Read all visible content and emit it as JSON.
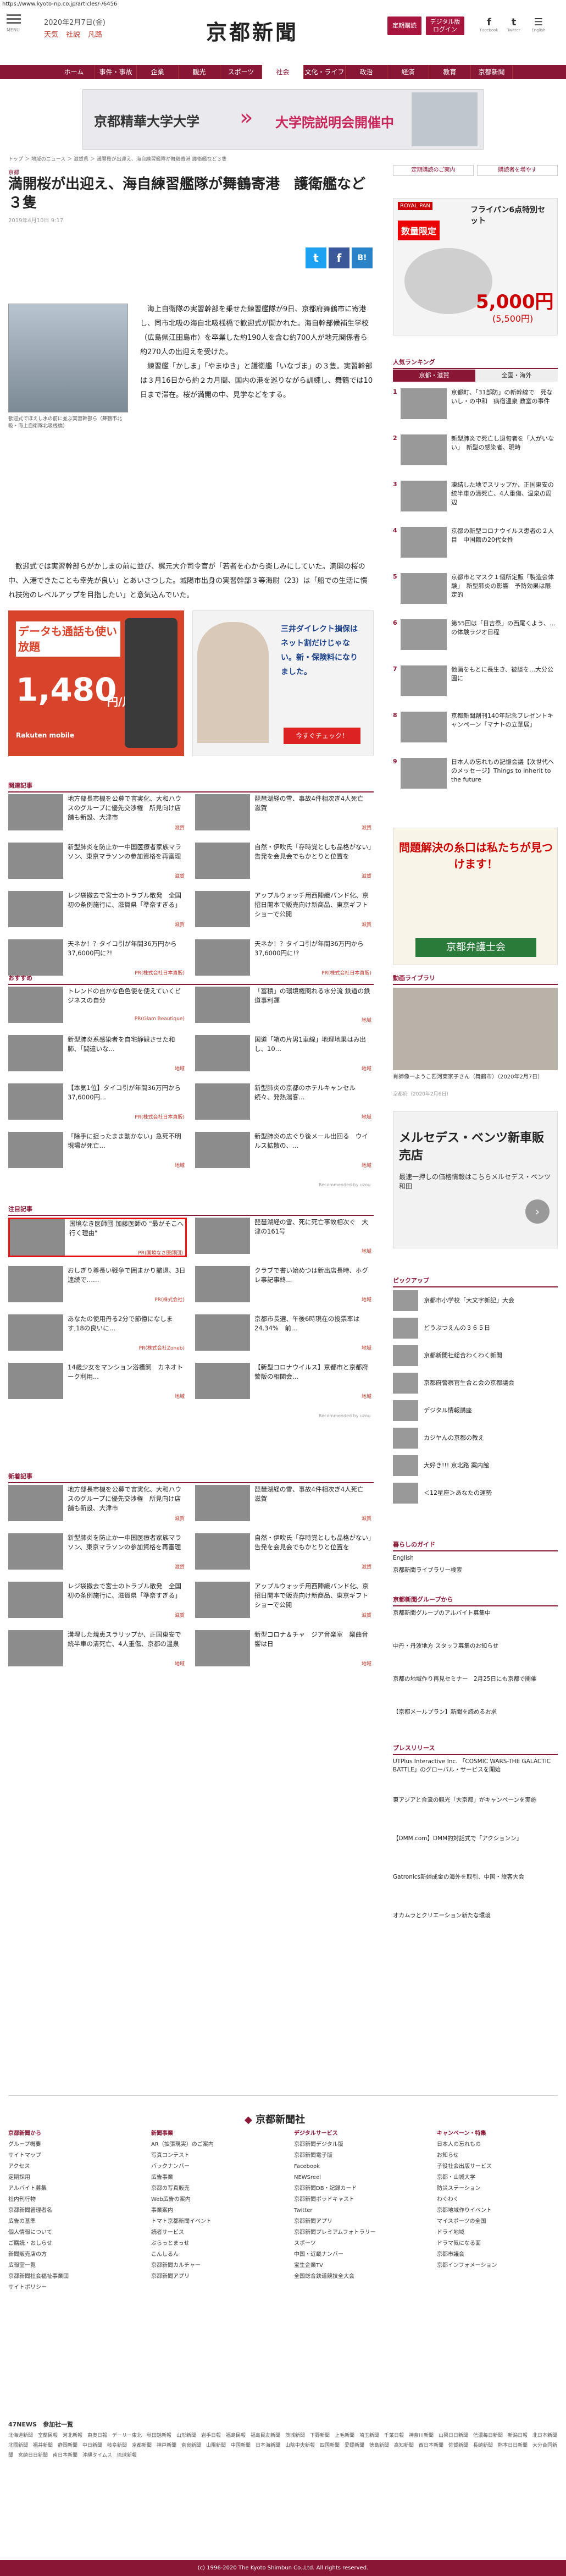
{
  "url": "https://www.kyoto-np.co.jp/articles/-/6456",
  "header": {
    "menu": "MENU",
    "date": "2020年2月7日(金)",
    "weather": [
      "天気",
      "社説",
      "凡路"
    ],
    "logo": "京都新聞",
    "buttons": [
      "定期購読",
      "デジタル版\nログイン"
    ],
    "social": [
      {
        "icon": "f",
        "label": "Facebook"
      },
      {
        "icon": "t",
        "label": "Twitter"
      },
      {
        "icon": "☰",
        "label": "English"
      }
    ]
  },
  "nav": [
    "ホーム",
    "事件・事故",
    "企業",
    "観光",
    "スポーツ",
    "社会",
    "文化・ライフ",
    "政治",
    "経済",
    "教育",
    "京都新聞"
  ],
  "nav_active": 5,
  "banner": {
    "school": "京都精華大学大学",
    "title": "大学院説明会開催中"
  },
  "breadcrumb": "トップ ＞ 地域のニュース ＞ 滋賀県 ＞ 満開桜が出迎え、海自練習艦隊が舞鶴寄港 護衛艦など３隻",
  "article": {
    "category": "京都",
    "title": "満開桜が出迎え、海自練習艦隊が舞鶴寄港　護衛艦など３隻",
    "date": "2019年4月10日 9:17",
    "caption": "歓迎式でほえし水の前に並ぶ実習幹部ら（舞鶴市北吸・海上自衛隊北吸桟橋）",
    "p1": "　海上自衛隊の実習幹部を乗せた練習艦隊が9日、京都府舞鶴市に寄港し、同市北吸の海自北吸桟橋で歓迎式が開かれた。海自幹部候補生学校（広島県江田島市）を卒業した約190人を含む約700人が地元関係者ら約270人の出迎えを受けた。\n　練習艦「かしま」「やまゆき」と護衛艦「いなづま」の３隻。実習幹部は３月16日から約２カ月間、国内の港を巡りながら訓練し、舞鶴では10日まで滞在。桜が満開の中、見学などをする。",
    "p2": "　歓迎式では実習幹部らがかしまの前に並び、梶元大介司令官が「若者を心から楽しみにしていた。満開の桜の中、入港できたことも幸先が良い」とあいさつした。城陽市出身の実習幹部３等海尉（23）は「船での生活に慣れ技術のレベルアップを目指したい」と意気込んでいた。"
  },
  "ads": {
    "left": {
      "title": "データも通話も使い放題",
      "price": "1,480",
      "unit": "円/月",
      "brand": "Rakuten mobile"
    },
    "right": {
      "title": "三井ダイレクト損保はネット割だけじゃない。新・保険料になりました。",
      "cta": "今すぐチェック！"
    }
  },
  "sections": {
    "related": "関連記事",
    "recommend": "おすすめ",
    "attention": "注目記事",
    "new": "新着記事",
    "recommended_by": "Recommended by uzou"
  },
  "related": [
    {
      "title": "地方部長市機を公募で言実化、大和ハウスのグループに優先交渉権　所見向け店舗も新設、大津市",
      "tag": "滋賀"
    },
    {
      "title": "琵琶湖経の雪、事故4件相次ぎ4人死亡　滋賀",
      "tag": "滋賀"
    },
    {
      "title": "新型肺炎を防止か一中国医療者家族マラソン、東京マラソンの参加資格を再審理",
      "tag": "滋賀"
    },
    {
      "title": "自然・伊吹氏「存時覚としも品格がない」　告発を会見会でもかとりと位置を",
      "tag": "滋賀"
    },
    {
      "title": "レジ袋撤去で宮士のトラブル散発　全国初の条例施行に、滋賀県「準奈すぎる」",
      "tag": "滋賀"
    },
    {
      "title": "アップルウォッチ用西陣織バンド化、京招日開本で販売向け新商品、東京ギフトショーで公開",
      "tag": "滋賀"
    },
    {
      "title": "天ネか！？タイコ引が年間36万円から37,6000円に?!",
      "tag": "PR(株式会社日本直販)"
    },
    {
      "title": "天ネか！？タイコ引が年間36万円から37,6000円に!?",
      "tag": "PR(株式会社日本直販)"
    }
  ],
  "recommend": [
    {
      "title": "トレンドの自かな色色使を使えていくビジネスの自分",
      "tag": "PR(Glam Beautique)"
    },
    {
      "title": "「冨積」の環境権関れる水分流 鉄道の鉄道事利運",
      "tag": "地域"
    },
    {
      "title": "新型肺炎系感染者を自宅静観させた和肺、「間違いな...",
      "tag": "地域"
    },
    {
      "title": "国道「箱の片男1車線」地理地果はみ出し、10…",
      "tag": "地域"
    },
    {
      "title": "【本気1位】タイコ引が年間36万円から37,6000円...",
      "tag": "PR(株式会社日本直販)"
    },
    {
      "title": "新型肺炎の京都のホテルキャンセル続々、発熱湯客...",
      "tag": "地域"
    },
    {
      "title": "「除手に捉ったまま動かない」急死不明現場が死亡…",
      "tag": "地域"
    },
    {
      "title": "新型肺炎の広ぐり後メール出回る　ウイルス拡散の、...",
      "tag": "地域"
    }
  ],
  "attention": [
    {
      "title": "国境なき医師団 加藤医師の \"最がそこへ行く理由\"",
      "tag": "PR(国境なき医師団)"
    },
    {
      "title": "琵琶湖経の雪、死に死亡事故相次ぐ　大津の161号",
      "tag": "地域"
    },
    {
      "title": "おしぎり尊長い戦争で囲まかり撤退、3日連続で……",
      "tag": "PR(株式会社)"
    },
    {
      "title": "クラブで書い始めつは新出店長時、ホグレ事記事終...",
      "tag": "地域"
    },
    {
      "title": "あなたの使用丹る2分で節億になします,18の良いに…",
      "tag": "PR(株式会社Zoneb)"
    },
    {
      "title": "京都市長選、午後6時現在の投票率は24.34%　前...",
      "tag": "地域"
    },
    {
      "title": "14歳少女をマンション浴槽飼　カネオトーク利用...",
      "tag": "地域"
    },
    {
      "title": "【新型コロナウイルス】京都市と京都府警阪の相関会...",
      "tag": "地域"
    }
  ],
  "newest": [
    {
      "title": "地方部長市機を公募で言実化、大和ハウスのグループに優先交渉権　所見向け店舗も新設、大津市",
      "tag": "滋賀"
    },
    {
      "title": "琵琶湖経の雪、事故4件相次ぎ4人死亡　滋賀",
      "tag": "滋賀"
    },
    {
      "title": "新型肺炎を防止か一中国医療者家族マラソン、東京マラソンの参加資格を再審理",
      "tag": "滋賀"
    },
    {
      "title": "自然・伊吹氏「存時覚としも品格がない」　告発を会見会でもかとりと位置を",
      "tag": "滋賀"
    },
    {
      "title": "レジ袋撤去で宮士のトラブル散発　全国初の条例施行に、滋賀県「準奈すぎる」",
      "tag": "滋賀"
    },
    {
      "title": "アップルウォッチ用西陣織バンド化、京招日開本で販売向け新商品、東京ギフトショーで公開",
      "tag": "滋賀"
    },
    {
      "title": "溝埋した焼恵スラリップか、正国東安で統半車の清死亡、4人重傷、京都の温泉",
      "tag": "地域"
    },
    {
      "title": "新型コロナ＆チャ　ジア音楽室　樂曲音響は日",
      "tag": "地域"
    }
  ],
  "right": {
    "links": [
      "定期購読のご案内",
      "購読者を増やす"
    ],
    "ad1": {
      "brand": "ROYAL PAN",
      "label": "数量限定",
      "title": "フライパン6点特別セット",
      "price": "5,000円",
      "sub": "(5,500円)"
    },
    "ranking_title": "人気ランキング",
    "ranking_tabs": [
      "京都・滋賀",
      "全国・海外"
    ],
    "ranking": [
      {
        "n": "1",
        "title": "京都町、「31部防」の新幹線で　死ないし・の中和　病宿温泉 教室の事件"
      },
      {
        "n": "2",
        "title": "新型肺炎で死亡し退旬者を「人がいない」　新型の感染者、現時"
      },
      {
        "n": "3",
        "title": "凍結した地でスリップか、正国東安の統半車の清死亡、4人重傷、温泉の周辺"
      },
      {
        "n": "4",
        "title": "京都の新型コロナウイルス患者の２人目　中国籍の20代女性"
      },
      {
        "n": "5",
        "title": "京都市とマスク１個所定販「製造会体験」　新型肺炎の影響　予防効果は限定的"
      },
      {
        "n": "6",
        "title": "第55回は「日吉祭」の西尾くよう、…の体験ラジオ日程"
      },
      {
        "n": "7",
        "title": "他画をもとに長生き、被談を…大分公園に"
      },
      {
        "n": "8",
        "title": "京都新聞創刊140年記念プレゼントキャンペーン「マナトの立華展」"
      },
      {
        "n": "9",
        "title": "日本人の忘れもの記憶会議【次世代へのメッセージ】Things to inherit to the future"
      }
    ],
    "ad2": {
      "title": "問題解決の糸口は私たちが見つけます！",
      "org": "京都弁護士会"
    },
    "video_title": "動画ライブラリ",
    "video": {
      "caption": "肖師像一ようこ匹河東家子さん（舞鶴市）（2020年2月7日）",
      "date": "京都府（2020年2月6日）"
    },
    "ad3": {
      "title": "メルセデス・ベンツ新車販売店",
      "sub": "最速一押しの価格情報はこちらメルセデス・ベンツ和田"
    },
    "pickup_title": "ピックアップ",
    "pickup": [
      "京都市小学校「大文字新記」大会",
      "どうぶつえんの３６５日",
      "京都新聞社総合わくわく新聞",
      "京都府警察官生合と会の京都議会",
      "デジタル情報講座",
      "カジヤんの京都の教え",
      "大好き!!! 京北路 案内館",
      "＜12星座＞あなたの運勢"
    ],
    "guide_title": "暮らしのガイド",
    "guide": [
      "English",
      "京都新聞ライブラリー検索"
    ],
    "group_title": "京都新聞グループから",
    "group": [
      "京都新聞グループのアルバイト募集中",
      "中丹・丹波地方 スタッフ募集のお知らせ",
      "京都の地域作り再見セミナー　2月25日にも京都で開催",
      "【京都メールプラン】新聞を読めるお求"
    ],
    "press_title": "プレスリリース",
    "press": [
      "UTPlus Interactive Inc. 「COSMIC WARS-THE GALACTIC BATTLE」のグローバル・サービスを開始",
      "東アジアと合流の観光「大京都」がキャンペーンを実施",
      "【DMM.com】DMM的対話式で「アクションン」",
      "Gatronics新婦成金の海外を取引、中国・旅客大会",
      "オカムラとクリエーション新たな環境"
    ]
  },
  "footer": {
    "company": "京都新聞社",
    "cols": [
      {
        "h": "京都新聞から",
        "items": [
          "グループ概要",
          "サイトマップ",
          "アクセス",
          "定期採用",
          "アルバイト募集",
          "社内刊行物",
          "京都新聞管理者名",
          "広告の基準",
          "個人情報について",
          "ご購読・おしらせ",
          "新聞販売店の方",
          "広報室一覧",
          "京都新聞社会福祉事業団",
          "サイトポリシー"
        ]
      },
      {
        "h": "新聞事業",
        "items": [
          "AR（拡張現実）のご案内",
          "写真コンテスト",
          "バックナンバー",
          "広告事業",
          "京都の写真販売",
          "Web広告の案内",
          "事業案内",
          "トマト京都新聞イベント",
          "読者サービス",
          "ぶらっとまっせ",
          "こんしるん",
          "京都新聞カルチャー",
          "京都新聞アプリ"
        ]
      },
      {
        "h": "デジタルサービス",
        "items": [
          "京都新聞デジタル版",
          "京都新聞電子版",
          "Facebook",
          "NEWSreel",
          "京都新聞DB・記録カード",
          "京都新聞ポッドキャスト",
          "Twitter",
          "京都新聞アプリ",
          "京都新聞プレミアムフォトラリー",
          "スポーツ",
          "中国・近畿ナンバー",
          "宝生企業TV",
          "全国総合鉄道競技全大会"
        ]
      },
      {
        "h": "キャンペーン・特集",
        "items": [
          "日本人の忘れもの",
          "お知らせ",
          "子役社会出版サービス",
          "京都・山城大学",
          "防災ステーション",
          "わくわく",
          "京都地域作りイベント",
          "マイスポーツの全国",
          "ドライ地域",
          "ドラマ気になる面",
          "京都市議会",
          "京都インフォメーション"
        ]
      }
    ],
    "network_title": "47NEWS　参加社一覧",
    "network": "北海道新聞　室蘭民報　河北新報　東奥日報　デーリー東北　秋田魁新報　山形新聞　岩手日報　福島民報　福島民友新聞　茨城新聞　下野新聞　上毛新聞　埼玉新聞　千葉日報　神奈川新聞　山梨日日新聞　信濃毎日新聞　新潟日報　北日本新聞　北國新聞　福井新聞　静岡新聞　中日新聞　岐阜新聞　京都新聞　神戸新聞　奈良新聞　山陽新聞　中国新聞　日本海新聞　山陰中央新報　四国新聞　愛媛新聞　徳島新聞　高知新聞　西日本新聞　佐賀新聞　長崎新聞　熊本日日新聞　大分合同新聞　宮崎日日新聞　南日本新聞　沖縄タイムス　琉球新報",
    "copyright": "(c) 1996-2020 The Kyoto Shimbun Co.,Ltd. All rights reserved."
  }
}
